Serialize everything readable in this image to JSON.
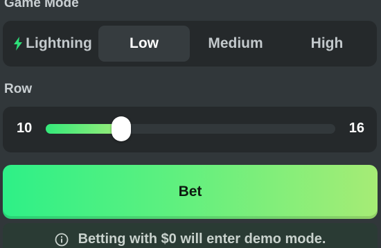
{
  "game_mode": {
    "label": "Game Mode",
    "tabs": [
      {
        "label": "Lightning",
        "icon": "bolt-icon",
        "active": false
      },
      {
        "label": "Low",
        "active": true
      },
      {
        "label": "Medium",
        "active": false
      },
      {
        "label": "High",
        "active": false
      }
    ]
  },
  "row": {
    "label": "Row",
    "min": "10",
    "max": "16",
    "value_fraction": 0.26
  },
  "bet": {
    "label": "Bet"
  },
  "notice": {
    "icon": "info-icon",
    "text": "Betting with $0 will enter demo mode."
  },
  "colors": {
    "accent_start": "#2ef087",
    "accent_end": "#a6ec75",
    "bolt": "#2ee079"
  }
}
